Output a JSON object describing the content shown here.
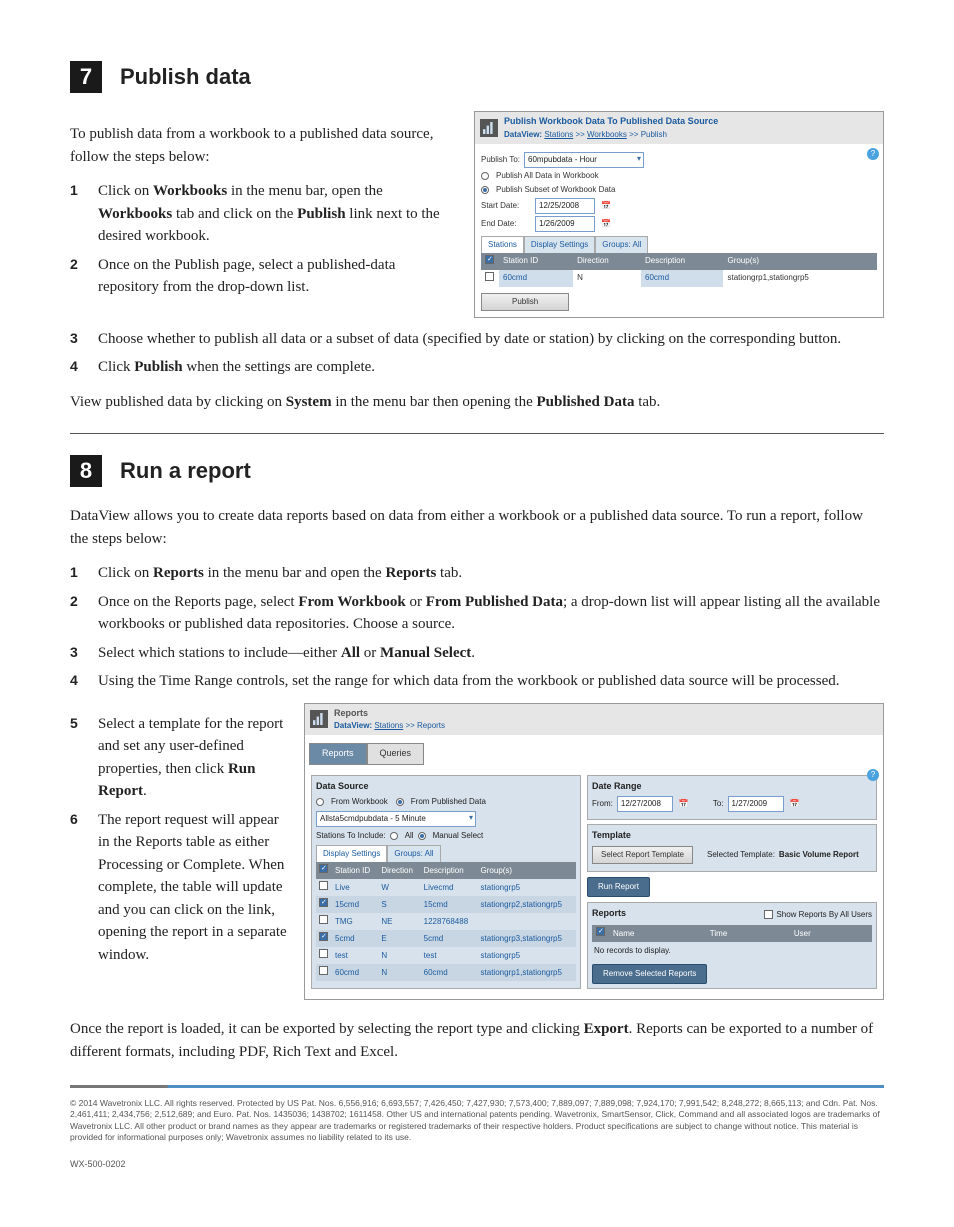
{
  "section7": {
    "badge": "7",
    "title": "Publish data",
    "intro": "To publish data from a workbook to a published data source, follow the steps below:",
    "steps": [
      {
        "num": "1",
        "pre": "Click on ",
        "b1": "Workbooks",
        "mid": " in the menu bar, open the ",
        "b2": "Workbooks",
        "mid2": " tab and click on the ",
        "b3": "Publish",
        "post": " link next to the desired workbook."
      },
      {
        "num": "2",
        "text": "Once on the Publish page, select a published-data repository from the drop-down list."
      },
      {
        "num": "3",
        "text": "Choose whether to publish all data or a subset of data (specified by date or station) by clicking on the corresponding button."
      },
      {
        "num": "4",
        "pre": "Click ",
        "b1": "Publish",
        "post": " when the settings are complete."
      }
    ],
    "outro_pre": "View published data by clicking on ",
    "outro_b1": "System",
    "outro_mid": " in the menu bar then opening the ",
    "outro_b2": "Published Data",
    "outro_post": " tab."
  },
  "pubApp": {
    "title": "Publish Workbook Data To Published Data Source",
    "crumb_pre": "DataView: ",
    "crumb1": "Stations",
    "crumb2": "Workbooks",
    "crumb3": "Publish",
    "publishToLabel": "Publish To:",
    "publishToValue": "60mpubdata - Hour",
    "radio1": "Publish All Data in Workbook",
    "radio2": "Publish Subset of Workbook Data",
    "startDateLabel": "Start Date:",
    "startDateValue": "12/25/2008",
    "endDateLabel": "End Date:",
    "endDateValue": "1/26/2009",
    "tabStations": "Stations",
    "tabDisplay": "Display Settings",
    "tabGroups": "Groups: ",
    "tabGroupsAll": "All",
    "th_check": "",
    "th_station": "Station ID",
    "th_direction": "Direction",
    "th_desc": "Description",
    "th_groups": "Group(s)",
    "row_station": "60cmd",
    "row_dir": "N",
    "row_desc": "60cmd",
    "row_groups": "stationgrp1,stationgrp5",
    "publishBtn": "Publish"
  },
  "section8": {
    "badge": "8",
    "title": "Run a report",
    "intro": "DataView allows you to create data reports based on data from either a workbook or a published data source. To run a report, follow the steps below:",
    "steps": [
      {
        "num": "1",
        "pre": "Click on ",
        "b1": "Reports",
        "mid": " in the menu bar and open the ",
        "b2": "Reports",
        "post": " tab."
      },
      {
        "num": "2",
        "pre": "Once on the Reports page, select ",
        "b1": "From Workbook",
        "mid": " or ",
        "b2": "From Published Data",
        "post": "; a drop-down list will appear listing all the available workbooks or published data repositories. Choose a source."
      },
      {
        "num": "3",
        "pre": "Select which stations to include—either ",
        "b1": "All",
        "mid": " or ",
        "b2": "Manual Select",
        "post": "."
      },
      {
        "num": "4",
        "text": "Using the Time Range controls, set the range for which data from the workbook or published data source will be processed."
      },
      {
        "num": "5",
        "pre": "Select a template for the report and set any user-defined properties, then click ",
        "b1": "Run Report",
        "post": "."
      },
      {
        "num": "6",
        "text": "The report request will appear in the Reports table as either Processing or Complete. When complete, the table will update and you can click on the link, opening the report in a separate window."
      }
    ],
    "outro_pre": "Once the report is loaded, it can be exported by selecting the report type and clicking ",
    "outro_b1": "Export",
    "outro_post": ". Reports can be exported to a number of different formats, including PDF, Rich Text and Excel."
  },
  "repApp": {
    "title": "Reports",
    "crumb_pre": "DataView: ",
    "crumb1": "Stations",
    "crumb2": "Reports",
    "tabReports": "Reports",
    "tabQueries": "Queries",
    "dataSourceTitle": "Data Source",
    "radioWorkbook": "From Workbook",
    "radioPublished": "From Published Data",
    "sourceSelect": "Allsta5cmdpubdata - 5 Minute",
    "stationsIncludeLabel": "Stations To Include:",
    "radioAll": "All",
    "radioManual": "Manual Select",
    "tabDisplay": "Display Settings",
    "tabGroups": "Groups: ",
    "tabGroupsAll": "All",
    "th_station": "Station ID",
    "th_dir": "Direction",
    "th_desc": "Description",
    "th_groups": "Group(s)",
    "rows": [
      {
        "chk": false,
        "id": "Live",
        "dir": "W",
        "desc": "Livecmd",
        "grp": "stationgrp5"
      },
      {
        "chk": true,
        "id": "15cmd",
        "dir": "S",
        "desc": "15cmd",
        "grp": "stationgrp2,stationgrp5"
      },
      {
        "chk": false,
        "id": "TMG",
        "dir": "NE",
        "desc": "1228768488",
        "grp": ""
      },
      {
        "chk": true,
        "id": "5cmd",
        "dir": "E",
        "desc": "5cmd",
        "grp": "stationgrp3,stationgrp5"
      },
      {
        "chk": false,
        "id": "test",
        "dir": "N",
        "desc": "test",
        "grp": "stationgrp5"
      },
      {
        "chk": false,
        "id": "60cmd",
        "dir": "N",
        "desc": "60cmd",
        "grp": "stationgrp1,stationgrp5"
      }
    ],
    "dateRangeTitle": "Date Range",
    "fromLabel": "From:",
    "fromValue": "12/27/2008",
    "toLabel": "To:",
    "toValue": "1/27/2009",
    "templateTitle": "Template",
    "selectTemplateBtn": "Select Report Template",
    "selectedTemplateLabel": "Selected Template:",
    "selectedTemplateValue": "Basic Volume Report",
    "runReportBtn": "Run Report",
    "reportsTitle": "Reports",
    "showAllLabel": "Show Reports By All Users",
    "th_name": "Name",
    "th_time": "Time",
    "th_user": "User",
    "noRecords": "No records to display.",
    "removeBtn": "Remove Selected Reports"
  },
  "footer": {
    "text": "© 2014 Wavetronix LLC. All rights reserved. Protected by US Pat. Nos. 6,556,916; 6,693,557; 7,426,450; 7,427,930; 7,573,400; 7,889,097; 7,889,098; 7,924,170; 7,991,542; 8,248,272; 8,665,113; and Cdn. Pat. Nos. 2,461,411; 2,434,756; 2,512,689; and Euro. Pat. Nos. 1435036; 1438702; 1611458. Other US and international patents pending. Wavetronix, SmartSensor, Click, Command and all associated logos are trademarks of Wavetronix LLC. All other product or brand names as they appear are trademarks or registered trademarks of their respective holders. Product specifications are subject to change without notice. This material is provided for informational purposes only; Wavetronix assumes no liability related to its use.",
    "docid": "WX-500-0202"
  }
}
